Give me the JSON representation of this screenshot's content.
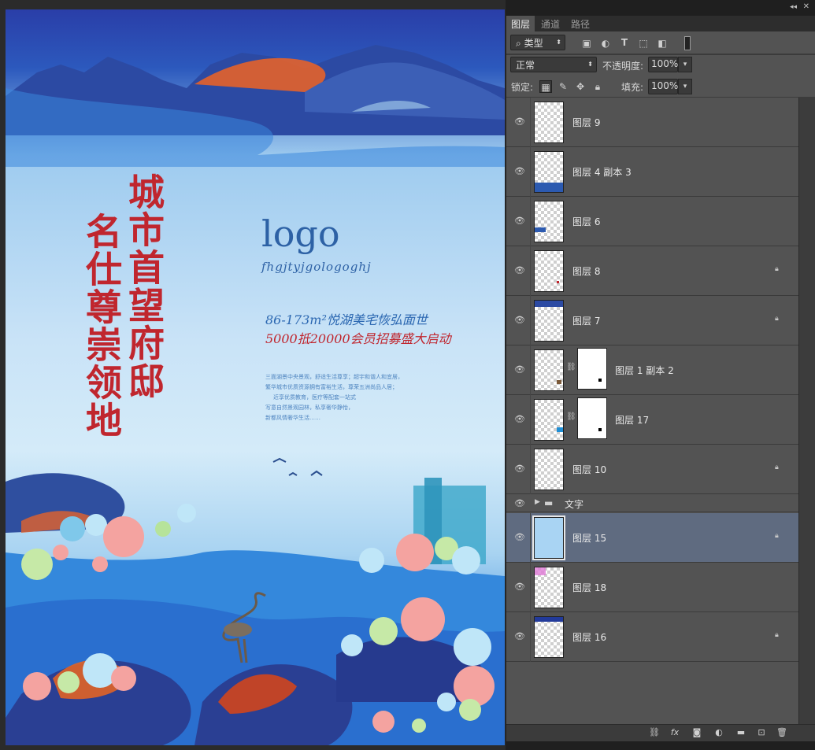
{
  "poster": {
    "vertical_left": "名仕尊崇领地",
    "vertical_right": "城市首望府邸",
    "logo": "logo",
    "logo_sub": "fhgjtyjgologoghj",
    "tagline1": "86-173m²悦湖美宅恢弘面世",
    "tagline2": "5000抵20000会员招募盛大启动",
    "paragraph": [
      "三面湖景中央景观，舒适生活尊享；超宇和谐人和宜居，",
      "繁华城市优质资源拥有富裕生活，尊荣五洲尚品人居；",
      "近享优质教育，医疗等配套一站式",
      "写意自然景观园林，私享奢华静怡，",
      "新都风情奢华生活……"
    ]
  },
  "panel": {
    "tabs": [
      "图层",
      "通道",
      "路径"
    ],
    "active_tab": "图层",
    "filter": {
      "icon": "search-icon",
      "label": "类型"
    },
    "blend_mode": "正常",
    "opacity_label": "不透明度:",
    "opacity_value": "100%",
    "lock_label": "锁定:",
    "fill_label": "填充:",
    "fill_value": "100%",
    "layers": [
      {
        "name": "图层 9",
        "locked": false,
        "selected": false,
        "mask": false
      },
      {
        "name": "图层 4 副本 3",
        "locked": false,
        "selected": false,
        "mask": false
      },
      {
        "name": "图层 6",
        "locked": false,
        "selected": false,
        "mask": false
      },
      {
        "name": "图层 8",
        "locked": true,
        "selected": false,
        "mask": false
      },
      {
        "name": "图层 7",
        "locked": true,
        "selected": false,
        "mask": false
      },
      {
        "name": "图层 1 副本 2",
        "locked": false,
        "selected": false,
        "mask": true
      },
      {
        "name": "图层 17",
        "locked": false,
        "selected": false,
        "mask": true
      },
      {
        "name": "图层 10",
        "locked": true,
        "selected": false,
        "mask": false
      }
    ],
    "group": {
      "name": "文字"
    },
    "layers_after": [
      {
        "name": "图层 15",
        "locked": true,
        "selected": true,
        "mask": false
      },
      {
        "name": "图层 18",
        "locked": false,
        "selected": false,
        "mask": false
      },
      {
        "name": "图层 16",
        "locked": true,
        "selected": false,
        "mask": false
      }
    ],
    "bottom_icons": [
      "link-icon",
      "fx-icon",
      "mask-icon",
      "adjustment-icon",
      "folder-icon",
      "new-layer-icon",
      "trash-icon"
    ]
  }
}
